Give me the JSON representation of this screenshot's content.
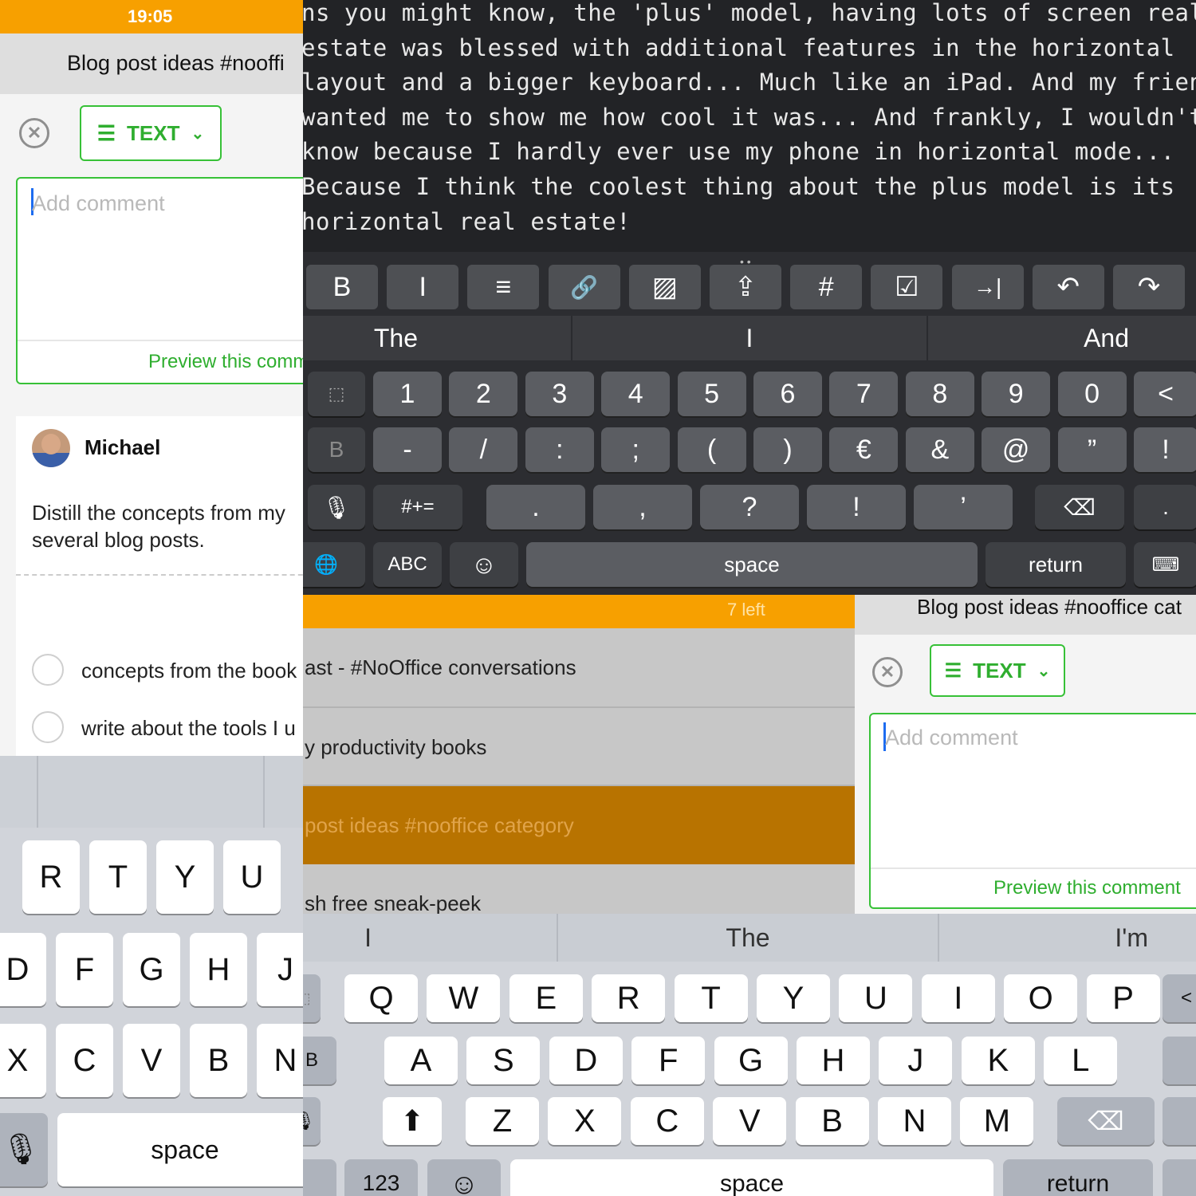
{
  "left_panel": {
    "status_time": "19:05",
    "title": "Blog post ideas #nooffi",
    "text_button": {
      "icon": "align-left-icon",
      "label": "TEXT",
      "chevron": "chevron-down-icon"
    },
    "comment": {
      "placeholder_first": "A",
      "placeholder_rest": "dd comment",
      "preview": "Preview this comm"
    },
    "author": {
      "name": "Michael"
    },
    "body": [
      "Distill the concepts from my",
      "several blog posts."
    ],
    "todos": [
      "concepts from the book",
      "write about the tools I u"
    ],
    "keyboard": {
      "row1": [
        "R",
        "T",
        "Y",
        "U"
      ],
      "row2": [
        "D",
        "F",
        "G",
        "H",
        "J"
      ],
      "row3": [
        "X",
        "C",
        "V",
        "B",
        "N"
      ],
      "space": "space"
    }
  },
  "editor": {
    "lines": [
      "ns you might know, the 'plus' model, having lots of screen real",
      "estate was blessed with additional features in the horizontal",
      "layout and a bigger keyboard... Much like an iPad. And my friend",
      "wanted me to show me how cool it was... And frankly, I wouldn't",
      "know because I hardly ever use my phone in horizontal mode...",
      "Because I think the coolest thing about the plus model is its",
      "horizontal real estate!"
    ],
    "toolbar": [
      {
        "name": "bold-button",
        "glyph": "B"
      },
      {
        "name": "italic-button",
        "glyph": "I"
      },
      {
        "name": "list-button",
        "glyph": "≡"
      },
      {
        "name": "link-button",
        "glyph": "🔗"
      },
      {
        "name": "image-button",
        "glyph": "▨"
      },
      {
        "name": "share-button",
        "glyph": "⇪"
      },
      {
        "name": "hashtag-button",
        "glyph": "#"
      },
      {
        "name": "checkbox-button",
        "glyph": "☑"
      },
      {
        "name": "indent-button",
        "glyph": "→|"
      },
      {
        "name": "undo-button",
        "glyph": "↶"
      },
      {
        "name": "redo-button",
        "glyph": "↷"
      }
    ],
    "suggestions": [
      "The",
      "I",
      "And"
    ],
    "keyboard": {
      "num_row": [
        "1",
        "2",
        "3",
        "4",
        "5",
        "6",
        "7",
        "8",
        "9",
        "0"
      ],
      "sym_row": [
        "-",
        "/",
        ":",
        ";",
        "(",
        ")",
        "€",
        "&",
        "@",
        "”"
      ],
      "punct_row": [
        ".",
        ",",
        "?",
        "!",
        "’"
      ],
      "left_b": "B",
      "more_label": "#+=",
      "abc_label": "ABC",
      "space": "space",
      "return": "return",
      "right_lt": "<",
      "right_bang": "!",
      "right_dot": "."
    }
  },
  "list_panel": {
    "header": "7 left",
    "items": [
      "ast - #NoOffice conversations",
      "y productivity books",
      "post ideas #nooffice category",
      "sh free sneak-peek"
    ]
  },
  "right_panel": {
    "title": "Blog post ideas #nooffice cat",
    "text_button": {
      "label": "TEXT"
    },
    "comment": {
      "placeholder_first": "A",
      "placeholder_rest": "dd comment",
      "preview": "Preview this comment"
    }
  },
  "bottom_keyboard": {
    "suggestions": [
      "I",
      "The",
      "I'm"
    ],
    "row1": [
      "Q",
      "W",
      "E",
      "R",
      "T",
      "Y",
      "U",
      "I",
      "O",
      "P"
    ],
    "row2": [
      "A",
      "S",
      "D",
      "F",
      "G",
      "H",
      "J",
      "K",
      "L"
    ],
    "row3": [
      "Z",
      "X",
      "C",
      "V",
      "B",
      "N",
      "M"
    ],
    "numbers_label": "123",
    "space": "space",
    "return": "return"
  },
  "colors": {
    "accent_orange": "#f7a000",
    "accent_green": "#37c137",
    "dark_bg": "#222326"
  }
}
